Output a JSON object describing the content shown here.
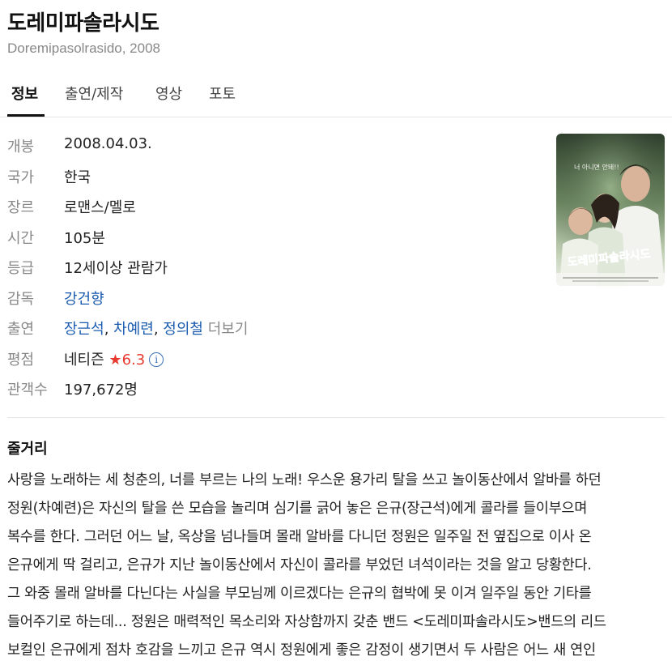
{
  "movie": {
    "title": "도레미파솔라시도",
    "subtitle": "Doremipasolrasido, 2008"
  },
  "tabs": [
    "정보",
    "출연/제작",
    "영상",
    "포토"
  ],
  "info": {
    "release": {
      "label": "개봉",
      "value": "2008.04.03."
    },
    "country": {
      "label": "국가",
      "value": "한국"
    },
    "genre": {
      "label": "장르",
      "value": "로맨스/멜로"
    },
    "runtime": {
      "label": "시간",
      "value": "105분"
    },
    "grade": {
      "label": "등급",
      "value": "12세이상 관람가"
    },
    "director": {
      "label": "감독",
      "value": "강건향"
    },
    "cast": {
      "label": "출연",
      "names": [
        "장근석",
        "차예련",
        "정의철"
      ],
      "separator": ", ",
      "more": "더보기"
    },
    "rating": {
      "label": "평점",
      "source": "네티즌",
      "star": "★",
      "score": "6.3"
    },
    "audience": {
      "label": "관객수",
      "value": "197,672명"
    }
  },
  "poster": {
    "text": "도레미파솔라시도",
    "tagline": "너 아니면 안돼!!"
  },
  "synopsis": {
    "title": "줄거리",
    "lines": [
      "사랑을 노래하는 세 청춘의, 너를 부르는 나의 노래! 우스운 용가리 탈을 쓰고 놀이동산에서 알바를 하던",
      "정원(차예련)은 자신의 탈을 쓴 모습을 놀리며 심기를 긁어 놓은 은규(장근석)에게 콜라를 들이부으며",
      "복수를 한다. 그러던 어느 날, 옥상을 넘나들며 몰래 알바를 다니던 정원은 일주일 전 옆집으로 이사 온",
      "은규에게 딱 걸리고, 은규가 지난 놀이동산에서 자신이 콜라를 부었던 녀석이라는 것을 알고 당황한다.",
      "그 와중 몰래 알바를 다닌다는 사실을 부모님께 이르겠다는 은규의 협박에 못 이겨 일주일 동안 기타를",
      "들어주기로 하는데... 정원은 매력적인 목소리와 자상함까지 갖춘 밴드 <도레미파솔라시도>밴드의 리드",
      "보컬인 은규에게 점차 호감을 느끼고 은규 역시 정원에게 좋은 감정이 생기면서 두 사람은 어느 새 연인"
    ]
  }
}
